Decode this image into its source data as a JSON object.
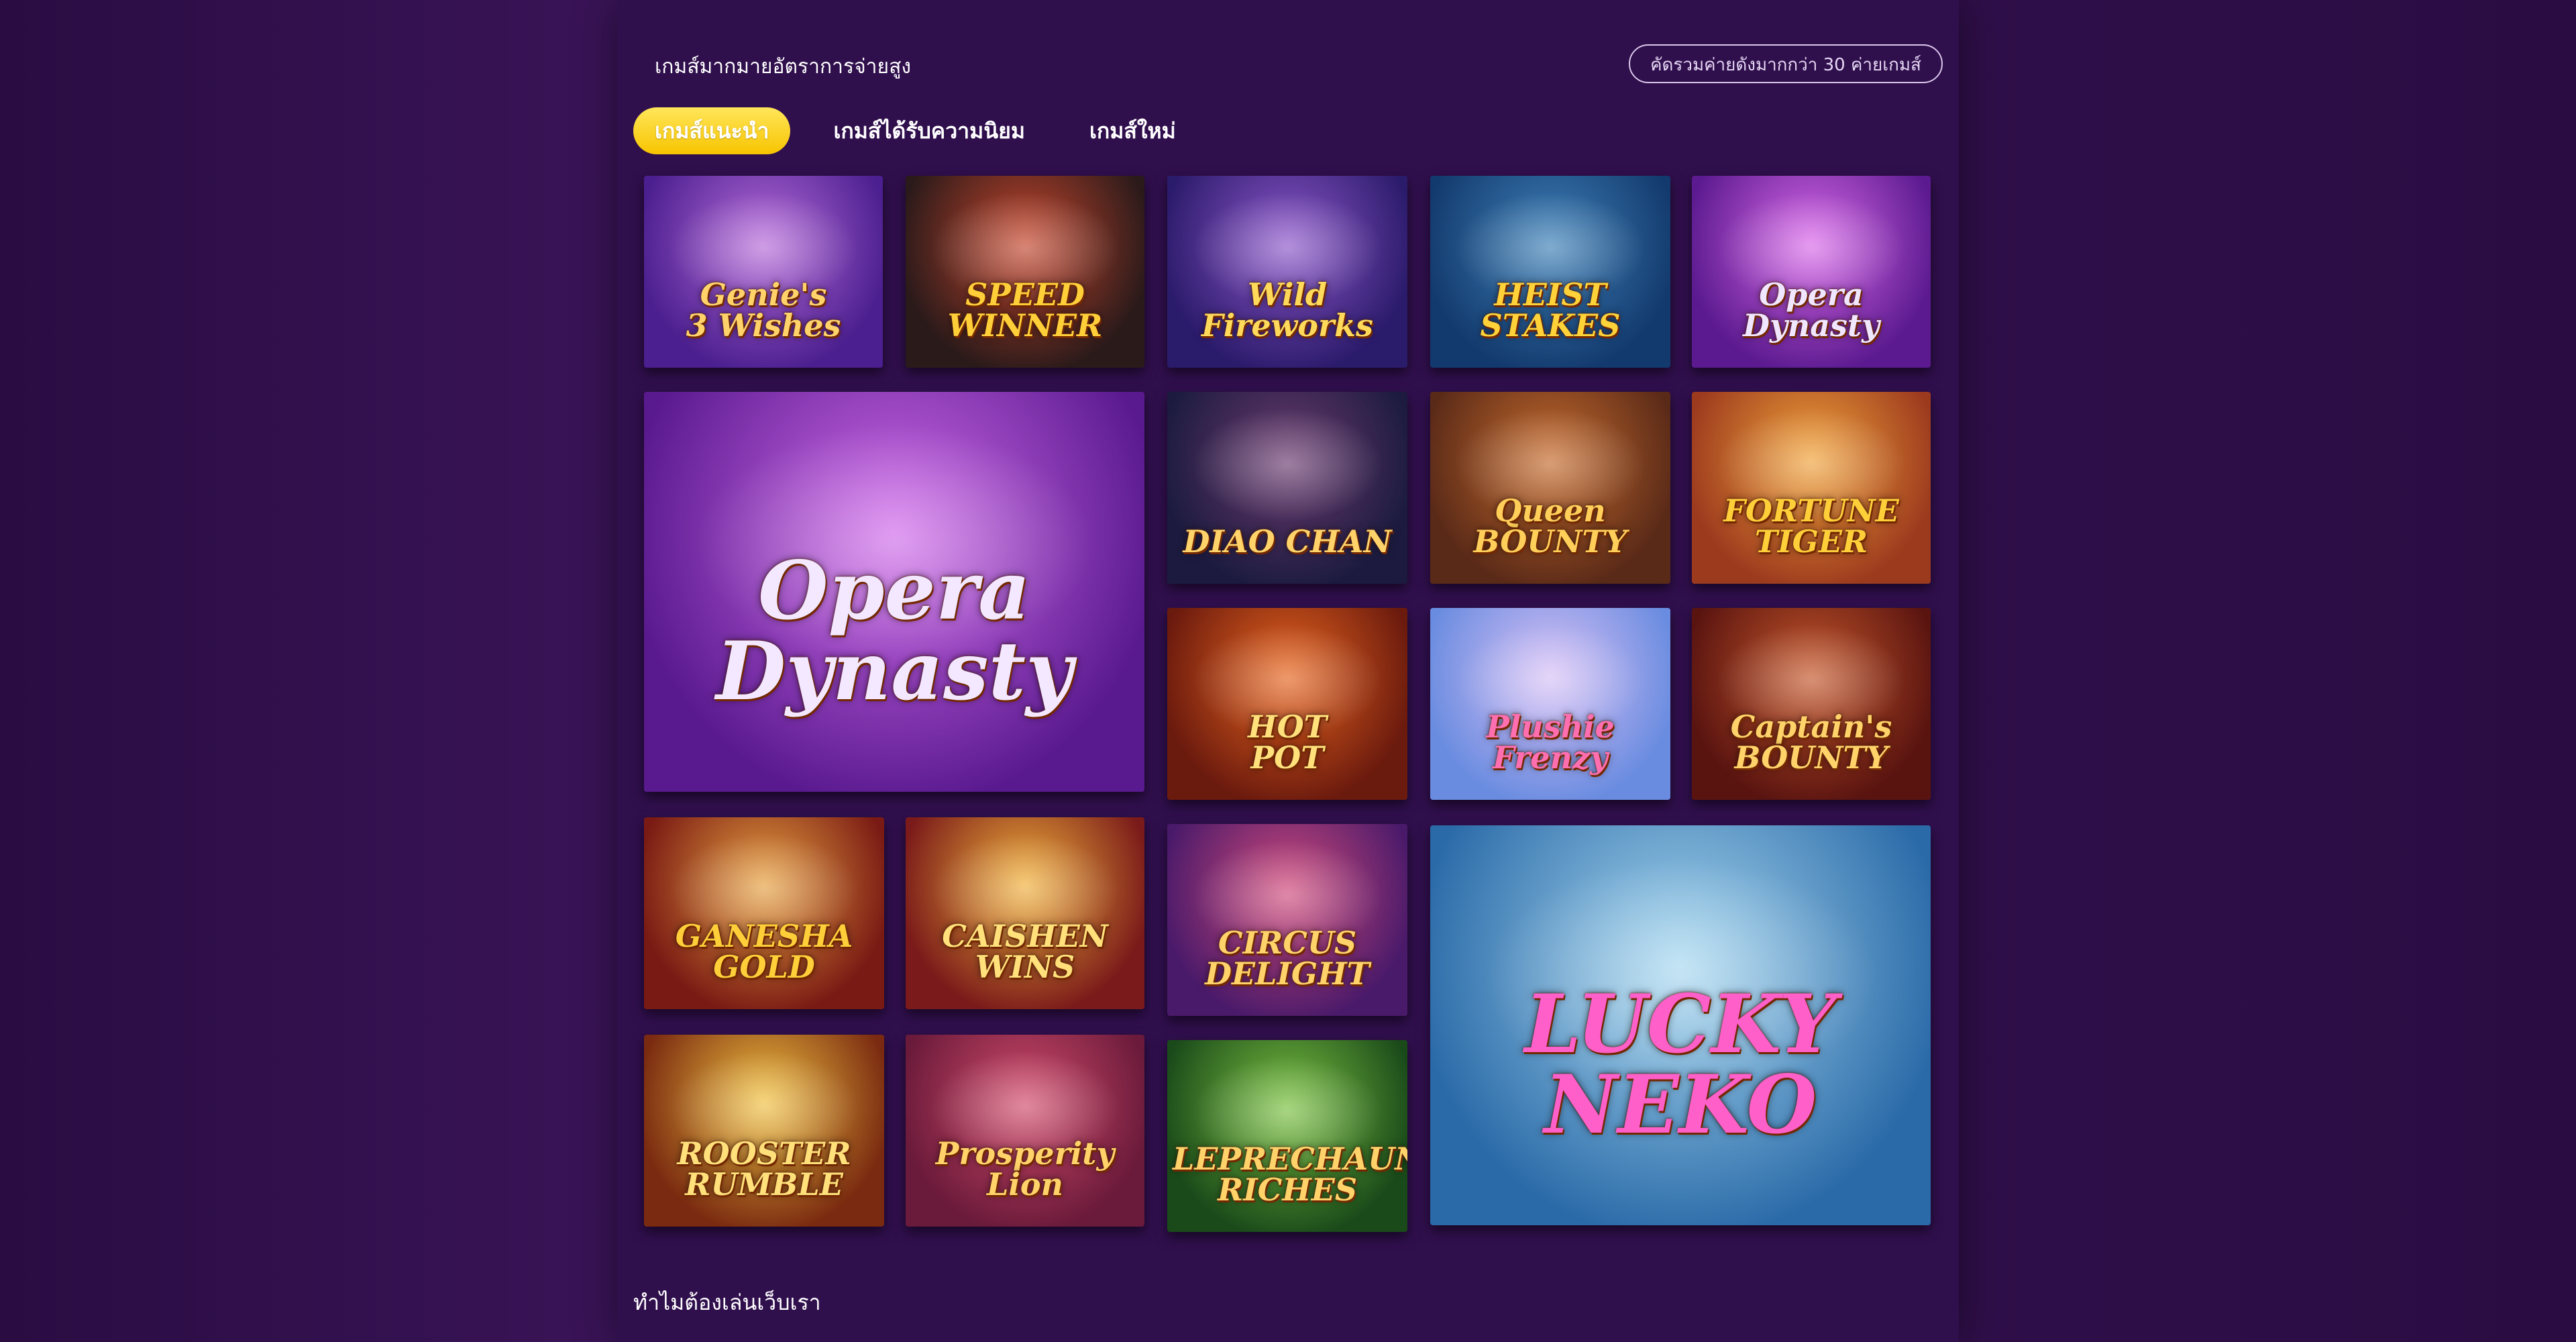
{
  "header": {
    "title": "เกมส์มากมายอัตราการจ่ายสูง",
    "badge": "คัดรวมค่ายดังมากกว่า 30 ค่ายเกมส์"
  },
  "tabs": [
    {
      "label": "เกมส์แนะนำ",
      "active": true
    },
    {
      "label": "เกมส์ได้รับความนิยม",
      "active": false
    },
    {
      "label": "เกมส์ใหม่",
      "active": false
    }
  ],
  "games": [
    {
      "name": "Genie's\n3 Wishes",
      "bg1": "#4b1f8f",
      "bg2": "#b56ad8",
      "text": "#ffd36a"
    },
    {
      "name": "SPEED\nWINNER",
      "bg1": "#2a1a1a",
      "bg2": "#c4452c",
      "text": "#ffcf3a"
    },
    {
      "name": "Wild\nFireworks",
      "bg1": "#2b1b6b",
      "bg2": "#8c56c9",
      "text": "#ffd95a"
    },
    {
      "name": "HEIST\nSTAKES",
      "bg1": "#133a6e",
      "bg2": "#3d7fb6",
      "text": "#ffd23a"
    },
    {
      "name": "Opera\nDynasty",
      "bg1": "#5b1a8f",
      "bg2": "#d868e8",
      "text": "#f1e6ff"
    },
    {
      "name": "Opera\nDynasty",
      "bg1": "#5a1a8f",
      "bg2": "#d06bea",
      "text": "#f3e8ff"
    },
    {
      "name": "DIAO CHAN",
      "bg1": "#1c1b3f",
      "bg2": "#6a3a6e",
      "text": "#ffd36a"
    },
    {
      "name": "Queen\nBOUNTY",
      "bg1": "#5a2a18",
      "bg2": "#c46a2c",
      "text": "#ffcf5a"
    },
    {
      "name": "FORTUNE\nTIGER",
      "bg1": "#9c3a1e",
      "bg2": "#f0a23a",
      "text": "#ffcf3a"
    },
    {
      "name": "HOT\nPOT",
      "bg1": "#6b1a0e",
      "bg2": "#e6641e",
      "text": "#ffe07a"
    },
    {
      "name": "Plushie\nFrenzy",
      "bg1": "#6a8ce0",
      "bg2": "#d7c0f5",
      "text": "#ff6fb0"
    },
    {
      "name": "Captain's\nBOUNTY",
      "bg1": "#5a1410",
      "bg2": "#c4562a",
      "text": "#ffd36a"
    },
    {
      "name": "GANESHA\nGOLD",
      "bg1": "#7a1a14",
      "bg2": "#e6a040",
      "text": "#ffcf3a"
    },
    {
      "name": "CAISHEN\nWINS",
      "bg1": "#7a1a1a",
      "bg2": "#f0b03a",
      "text": "#ffe07a"
    },
    {
      "name": "CIRCUS\nDELIGHT",
      "bg1": "#4a1a6a",
      "bg2": "#d04a7a",
      "text": "#ffd36a"
    },
    {
      "name": "LUCKY\nNEKO",
      "bg1": "#2a6aa8",
      "bg2": "#a8d8f0",
      "text": "#ff5fc8"
    },
    {
      "name": "ROOSTER\nRUMBLE",
      "bg1": "#7a2a10",
      "bg2": "#f0c040",
      "text": "#ffe07a"
    },
    {
      "name": "Prosperity\nLion",
      "bg1": "#6a1a3a",
      "bg2": "#d04a6a",
      "text": "#ffd36a"
    },
    {
      "name": "LEPRECHAUN\nRICHES",
      "bg1": "#1a4a1a",
      "bg2": "#7ac040",
      "text": "#ffd36a"
    }
  ],
  "footer": {
    "title": "ทำไมต้องเล่นเว็บเรา"
  }
}
